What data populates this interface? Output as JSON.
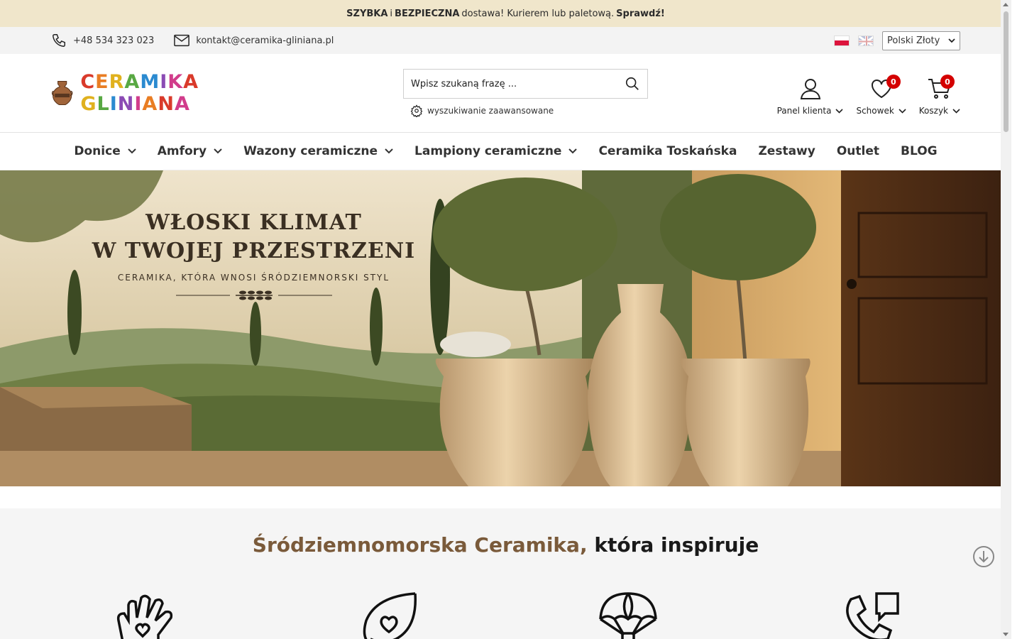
{
  "promo": {
    "part1": "SZYBKA",
    "part2": "i",
    "part3": "BEZPIECZNA",
    "part4": "dostawa! Kurierem lub paletową.",
    "cta": "Sprawdź!"
  },
  "contact": {
    "phone": "+48 534 323 023",
    "email": "kontakt@ceramika-gliniana.pl",
    "currency": "Polski Złoty"
  },
  "logo": {
    "letters": [
      "C",
      "E",
      "R",
      "A",
      "M",
      "I",
      "K",
      "A",
      " ",
      "G",
      "L",
      "I",
      "N",
      "I",
      "A",
      "N",
      "A"
    ]
  },
  "search": {
    "placeholder": "Wpisz szukaną frazę ...",
    "advanced": "wyszukiwanie zaawansowane"
  },
  "actions": {
    "account": "Panel klienta",
    "wishlist": "Schowek",
    "wishlist_count": "0",
    "cart": "Koszyk",
    "cart_count": "0"
  },
  "nav": {
    "items": [
      {
        "label": "Donice"
      },
      {
        "label": "Amfory"
      },
      {
        "label": "Wazony ceramiczne"
      },
      {
        "label": "Lampiony ceramiczne"
      },
      {
        "label": "Ceramika Toskańska"
      },
      {
        "label": "Zestawy"
      },
      {
        "label": "Outlet"
      },
      {
        "label": "BLOG"
      }
    ]
  },
  "hero": {
    "title_line1": "WŁOSKI KLIMAT",
    "title_line2": "W TWOJEJ PRZESTRZENI",
    "subtitle": "CERAMIKA, KTÓRA WNOSI ŚRÓDZIEMNORSKI STYL"
  },
  "section": {
    "title_brown": "Śródziemnomorska Ceramika,",
    "title_dark": "która inspiruje"
  },
  "colors": {
    "promo_bg": "#f0e6cb",
    "badge": "#d40000",
    "title_brown": "#7a5a3a"
  }
}
